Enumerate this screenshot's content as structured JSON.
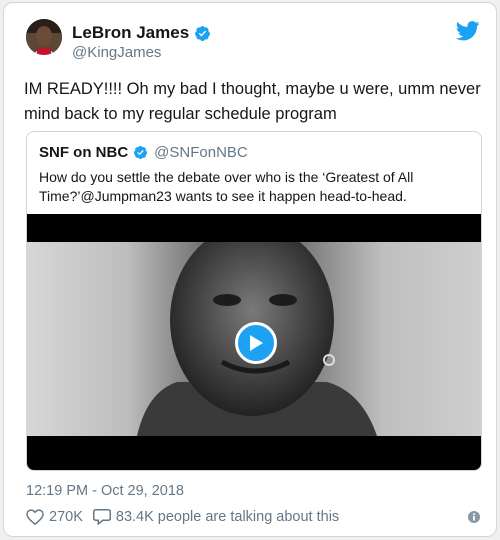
{
  "author": {
    "name": "LeBron James",
    "handle": "@KingJames",
    "verified_icon": "verified-badge-icon",
    "avatar_icon": "profile-photo"
  },
  "tweet": {
    "text": "IM READY!!!! Oh my bad I thought, maybe u were, umm never mind back to my regular schedule program"
  },
  "quoted": {
    "name": "SNF on NBC",
    "handle": "@SNFonNBC",
    "text": "How do you settle the debate over who is the ‘Greatest of All Time?’@Jumpman23 wants to see it happen head-to-head.",
    "media": "video",
    "play_icon": "play-icon"
  },
  "timestamp": "12:19 PM - Oct 29, 2018",
  "stats": {
    "likes": "270K",
    "talking": "83.4K people are talking about this"
  },
  "colors": {
    "brand": "#1da1f2",
    "text": "#14171a",
    "secondary": "#657786",
    "border": "#ccd6dd"
  }
}
